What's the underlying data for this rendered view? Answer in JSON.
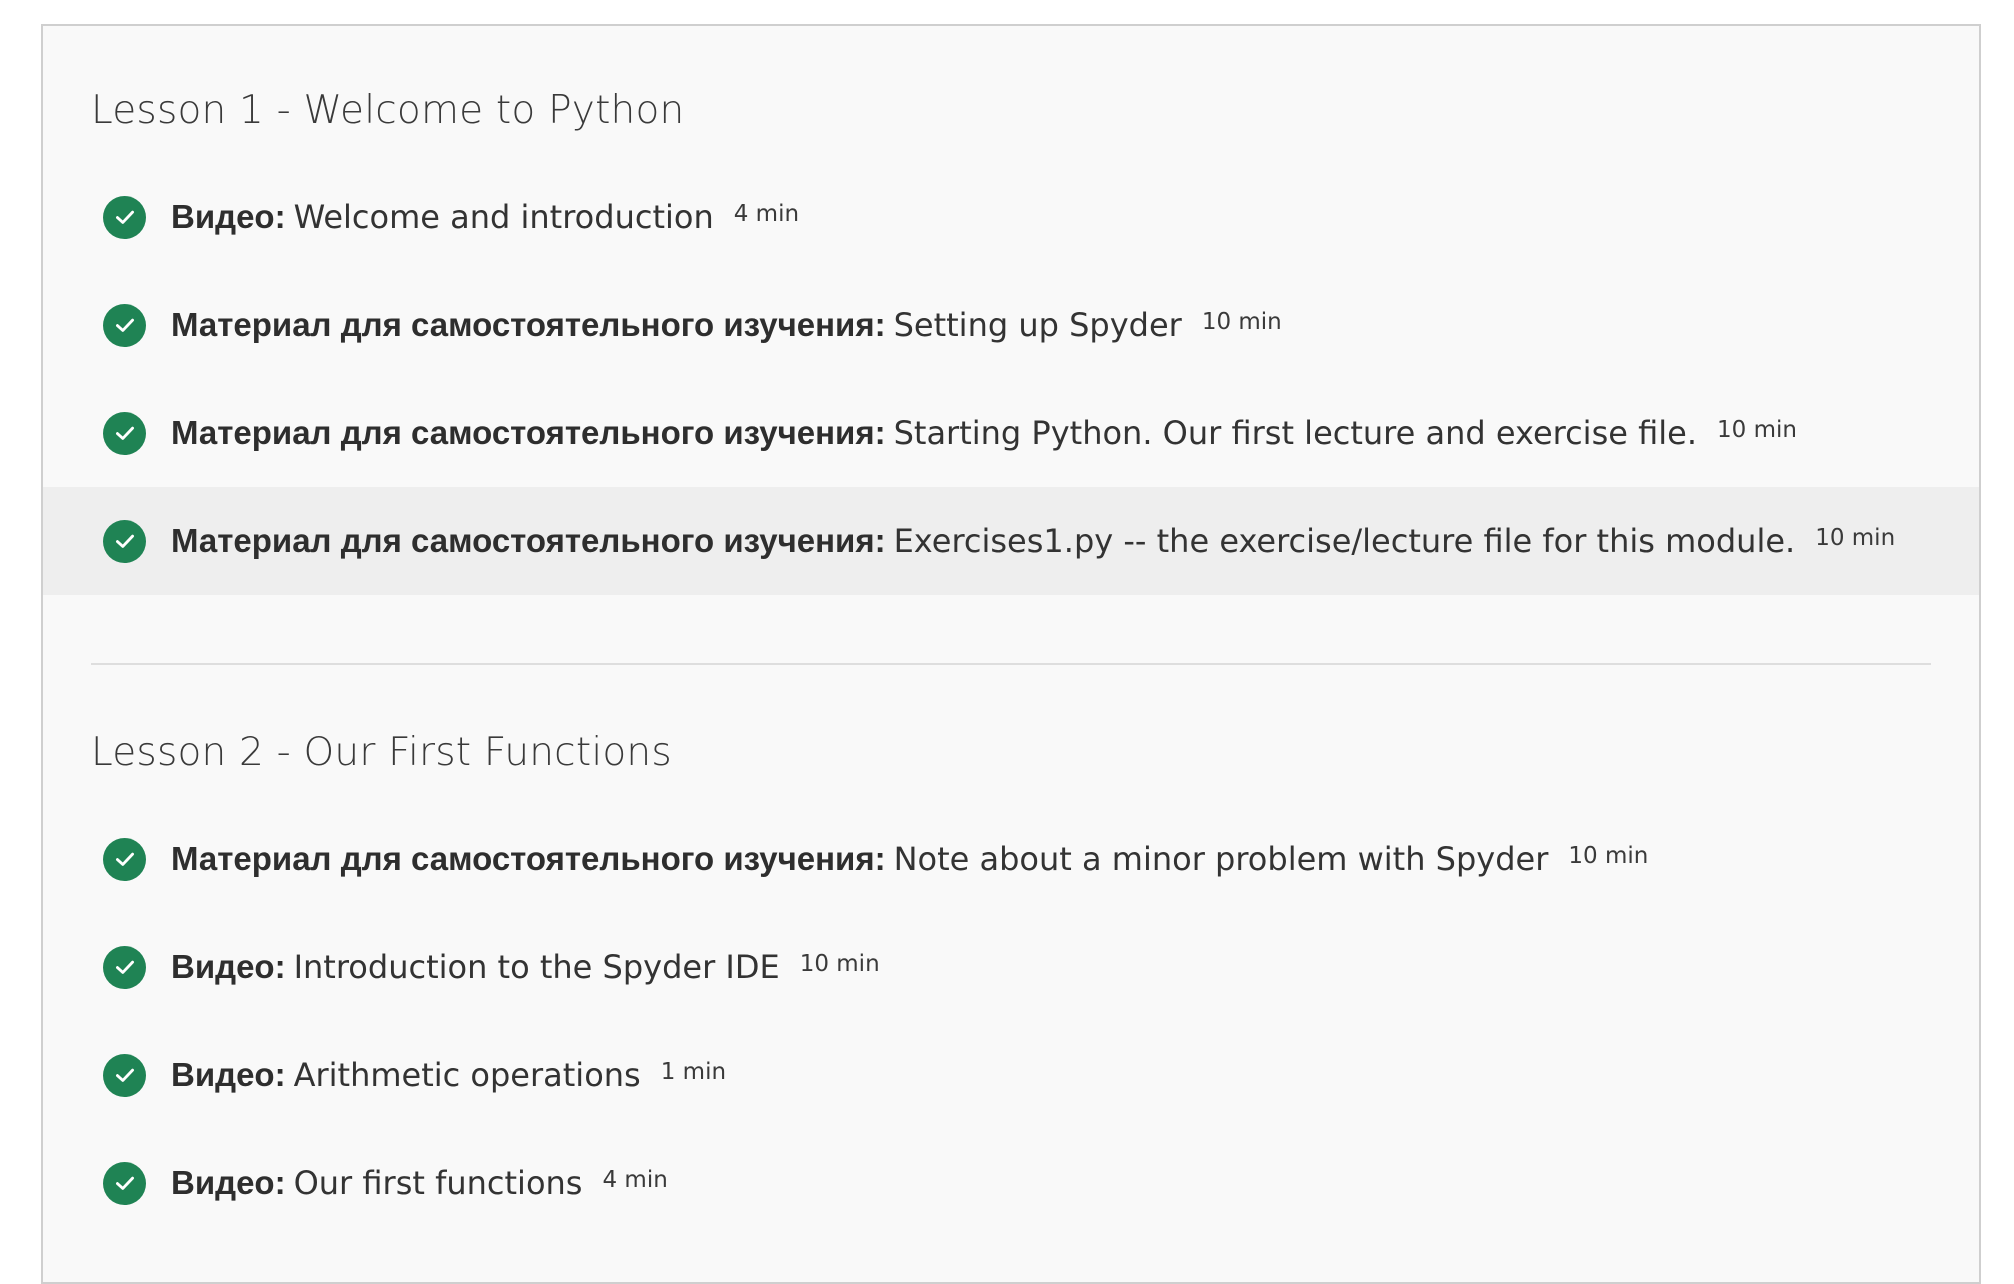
{
  "lessons": [
    {
      "title": "Lesson 1 - Welcome to Python",
      "items": [
        {
          "type": "Видео:",
          "name": "Welcome and introduction",
          "duration": "4 min"
        },
        {
          "type": "Материал для самостоятельного изучения:",
          "name": "Setting up Spyder",
          "duration": "10 min"
        },
        {
          "type": "Материал для самостоятельного изучения:",
          "name": "Starting Python. Our first lecture and exercise file.",
          "duration": "10 min"
        },
        {
          "type": "Материал для самостоятельного изучения:",
          "name": "Exercises1.py -- the exercise/lecture file for this module.",
          "duration": "10 min"
        }
      ]
    },
    {
      "title": "Lesson 2 - Our First Functions",
      "items": [
        {
          "type": "Материал для самостоятельного изучения:",
          "name": "Note about a minor problem with Spyder",
          "duration": "10 min"
        },
        {
          "type": "Видео:",
          "name": "Introduction to the Spyder IDE",
          "duration": "10 min"
        },
        {
          "type": "Видео:",
          "name": "Arithmetic operations",
          "duration": "1 min"
        },
        {
          "type": "Видео:",
          "name": "Our first functions",
          "duration": "4 min"
        }
      ]
    }
  ],
  "icons": {
    "completed": "check-circle-icon"
  },
  "colors": {
    "check_green": "#1f8354",
    "hover_row": "#eeeeee",
    "panel_bg": "#f9f9f9"
  }
}
